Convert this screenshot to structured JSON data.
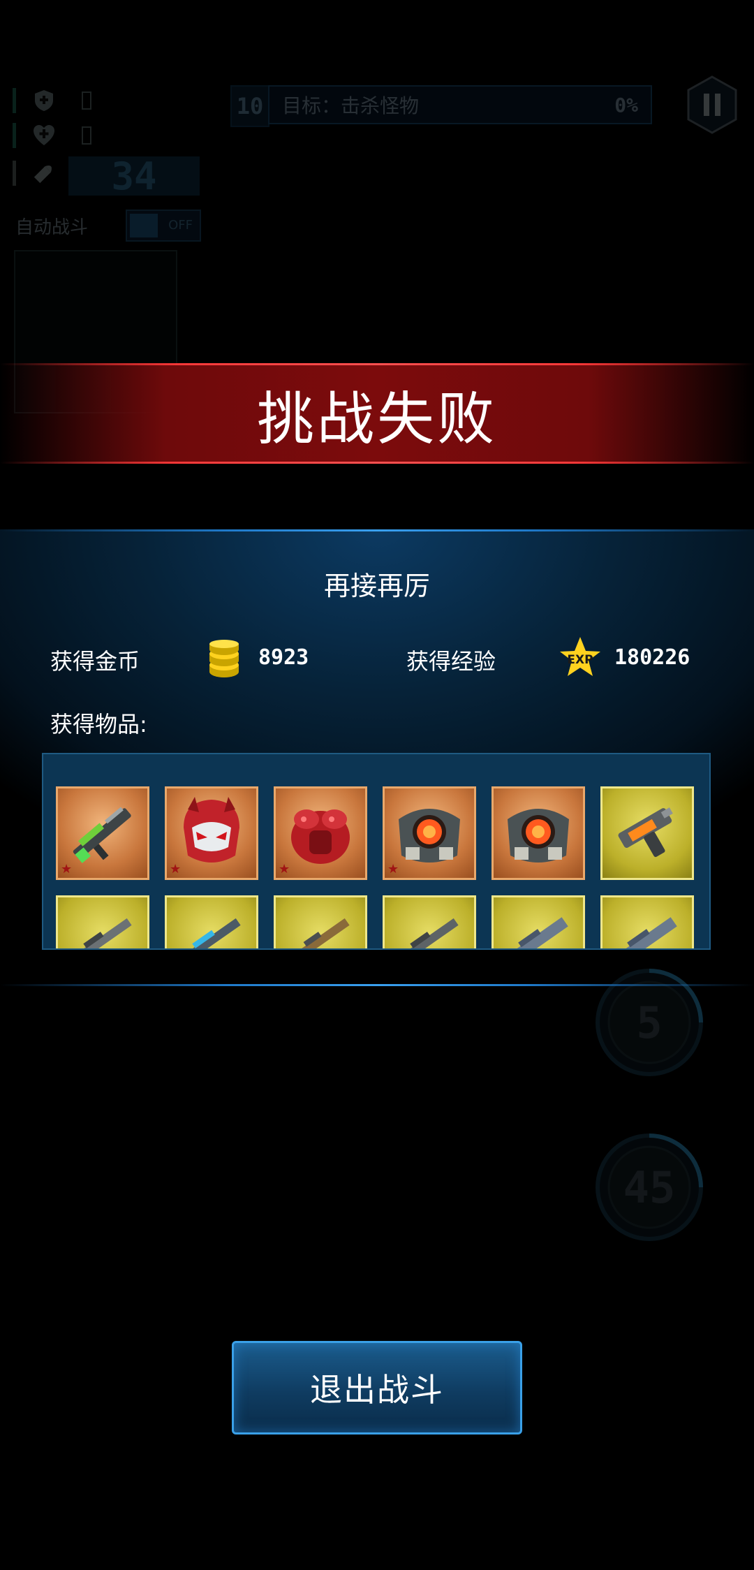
{
  "hud": {
    "ammo": "34",
    "auto_battle_label": "自动战斗",
    "auto_battle_toggle": "OFF",
    "goal_number": "10",
    "goal_text": "目标：击杀怪物",
    "goal_percent": "0%",
    "skill_1_count": "5",
    "skill_2_count": "45"
  },
  "banner": {
    "title": "挑战失败"
  },
  "result": {
    "subtitle": "再接再厉",
    "gold_label": "获得金币",
    "gold_value": "8923",
    "exp_label": "获得经验",
    "exp_value": "180226",
    "items_label": "获得物品:",
    "items": [
      {
        "icon": "assault-rifle-icon",
        "rarity": "orange",
        "starred": true
      },
      {
        "icon": "red-helmet-icon",
        "rarity": "orange",
        "starred": true
      },
      {
        "icon": "red-armor-icon",
        "rarity": "orange",
        "starred": true
      },
      {
        "icon": "chest-core-icon",
        "rarity": "orange",
        "starred": true
      },
      {
        "icon": "chest-core-icon",
        "rarity": "orange",
        "starred": false
      },
      {
        "icon": "orange-pistol-icon",
        "rarity": "gold",
        "starred": false
      },
      {
        "icon": "rifle-icon",
        "rarity": "gold",
        "starred": false
      },
      {
        "icon": "blue-rifle-icon",
        "rarity": "gold",
        "starred": false
      },
      {
        "icon": "shotgun-icon",
        "rarity": "gold",
        "starred": false
      },
      {
        "icon": "rifle-icon",
        "rarity": "gold",
        "starred": false
      },
      {
        "icon": "heavy-gun-icon",
        "rarity": "gold",
        "starred": false
      },
      {
        "icon": "heavy-gun-icon",
        "rarity": "gold",
        "starred": false
      }
    ]
  },
  "exit_button": {
    "label": "退出战斗"
  },
  "colors": {
    "banner_red": "#7c0b0c",
    "panel_blue": "#0c3553",
    "button_border": "#3aa0e8",
    "rarity_orange": "#c9773d",
    "rarity_gold": "#bcb02a"
  }
}
